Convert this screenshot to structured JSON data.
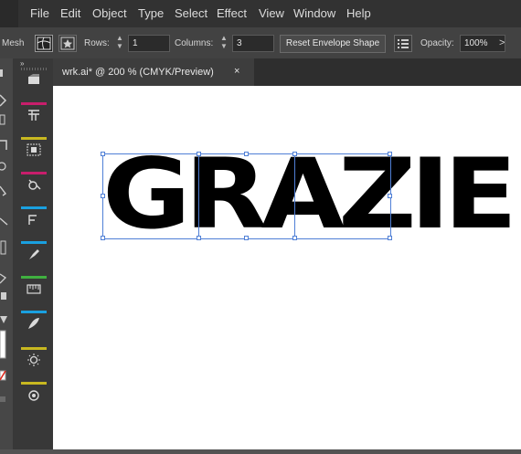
{
  "menu": [
    "File",
    "Edit",
    "Object",
    "Type",
    "Select",
    "Effect",
    "View",
    "Window",
    "Help"
  ],
  "control_bar": {
    "mode_label": "Mesh",
    "rows_label": "Rows:",
    "rows_value": "1",
    "columns_label": "Columns:",
    "columns_value": "3",
    "reset_button": "Reset Envelope Shape",
    "opacity_label": "Opacity:",
    "opacity_value": "100%",
    "opacity_arrow": ">"
  },
  "document_tab": {
    "title": "wrk.ai* @ 200 % (CMYK/Preview)",
    "close": "×"
  },
  "panel_collapse": "»",
  "artwork": {
    "text": "GRAZIE"
  },
  "colors": {
    "selection": "#4f7fd6",
    "app_bg": "#535353"
  }
}
